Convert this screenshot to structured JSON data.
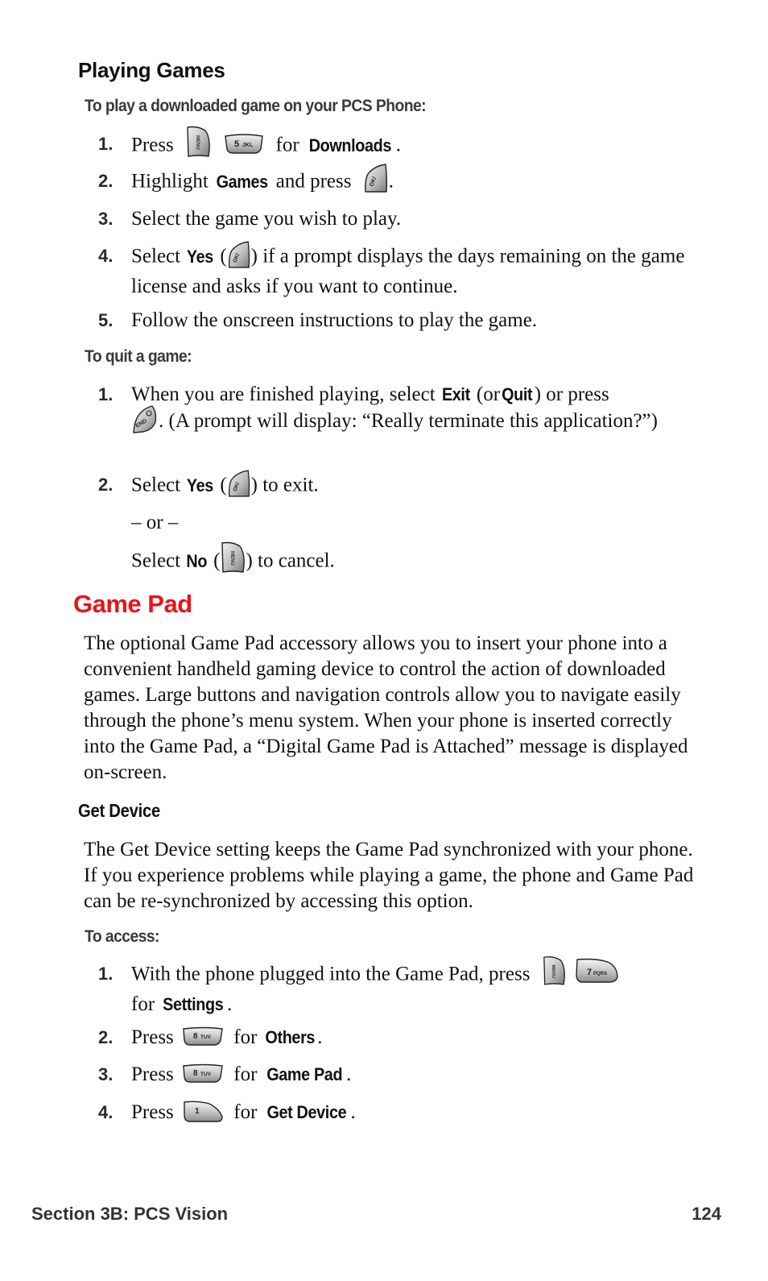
{
  "section1": {
    "title": "Playing Games",
    "intro": "To play a downloaded game on your PCS Phone:",
    "steps": [
      {
        "num": "1.",
        "pre": "Press",
        "keys": [
          "menu-key",
          "5-jkl-key"
        ],
        "mid": "for",
        "bold": "Downloads",
        "post": "."
      },
      {
        "num": "2.",
        "pre": "Highlight",
        "bold": "Games",
        "mid": "and press",
        "keys": [
          "ok-key"
        ],
        "post": "."
      },
      {
        "num": "3.",
        "text": "Select the game you wish to play."
      },
      {
        "num": "4.",
        "pre": "Select",
        "bold": "Yes",
        "open": "(",
        "keys": [
          "ok-key"
        ],
        "post": ") if a prompt displays the days remaining on the game license and asks if you want to continue."
      },
      {
        "num": "5.",
        "text": "Follow the onscreen instructions to play the game."
      }
    ],
    "quit_intro": "To quit a game:",
    "quit_steps": [
      {
        "num": "1.",
        "pre": "When you are finished playing, select",
        "bold1": "Exit",
        "mid": "(or",
        "bold2": "Quit",
        "mid2": ") or press",
        "keys": [
          "end-key"
        ],
        "post": ". (A prompt will display: “Really terminate this application?”)"
      },
      {
        "num": "2.",
        "pre": "Select",
        "bold": "Yes",
        "open": "(",
        "keys": [
          "ok-key"
        ],
        "post": ") to exit."
      }
    ],
    "or_text": "– or –",
    "cancel": {
      "pre": "Select",
      "bold": "No",
      "open": "(",
      "keys": [
        "menu-key"
      ],
      "post": ") to cancel."
    }
  },
  "section2": {
    "title": "Game Pad",
    "title_color": "#e8141c",
    "paragraph": "The optional Game Pad accessory allows you to insert your phone into a convenient handheld gaming device to control the action of downloaded games. Large buttons and navigation controls allow you to navigate easily through the phone’s menu system. When your phone is inserted correctly into the Game Pad, a “Digital Game Pad is Attached” message is displayed on-screen.",
    "subsection": {
      "title": "Get Device",
      "paragraph": "The Get Device setting keeps the Game Pad synchronized with your phone. If you experience problems while playing a game, the phone and Game Pad can be re-synchronized by accessing this option.",
      "access_intro": "To access:",
      "steps": [
        {
          "num": "1.",
          "pre": "With the phone plugged into the Game Pad, press",
          "keys": [
            "menu-key",
            "7-pqrs-key"
          ],
          "mid": "for",
          "bold": "Settings",
          "post": "."
        },
        {
          "num": "2.",
          "pre": "Press",
          "keys": [
            "8-tuv-key"
          ],
          "mid": "for",
          "bold": "Others",
          "post": "."
        },
        {
          "num": "3.",
          "pre": "Press",
          "keys": [
            "8-tuv-key"
          ],
          "mid": "for",
          "bold": "Game Pad",
          "post": "."
        },
        {
          "num": "4.",
          "pre": "Press",
          "keys": [
            "1-key"
          ],
          "mid": "for",
          "bold": "Get Device",
          "post": "."
        }
      ]
    }
  },
  "key_labels": {
    "menu": "MENU",
    "five": "5",
    "five_sub": "JKL",
    "ok": "OK/",
    "end": "END",
    "seven": "7",
    "seven_sub": "PQRS",
    "eight": "8",
    "eight_sub": "TUV",
    "one": "1"
  },
  "footer": {
    "section": "Section 3B: PCS Vision",
    "page": "124"
  }
}
